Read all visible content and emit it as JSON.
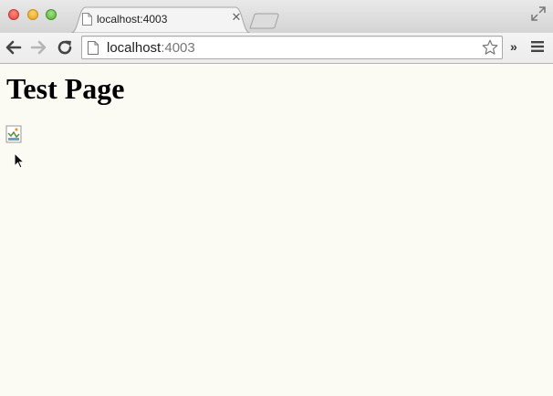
{
  "browser": {
    "tab": {
      "title": "localhost:4003"
    },
    "address_bar": {
      "host": "localhost",
      "port": ":4003"
    },
    "icons": [
      "window-close-icon",
      "window-minimize-icon",
      "window-maximize-icon",
      "page-favicon-icon",
      "tab-close-icon",
      "new-tab-icon",
      "fullscreen-icon",
      "back-icon",
      "forward-icon",
      "reload-icon",
      "page-icon",
      "bookmark-star-icon",
      "chevron-right-icon",
      "menu-icon"
    ]
  },
  "page": {
    "heading": "Test Page",
    "image": "broken-image-icon"
  },
  "colors": {
    "page_background": "#fbfbf4",
    "close": "#e0443e",
    "minimize": "#dea123",
    "maximize": "#57b035"
  }
}
